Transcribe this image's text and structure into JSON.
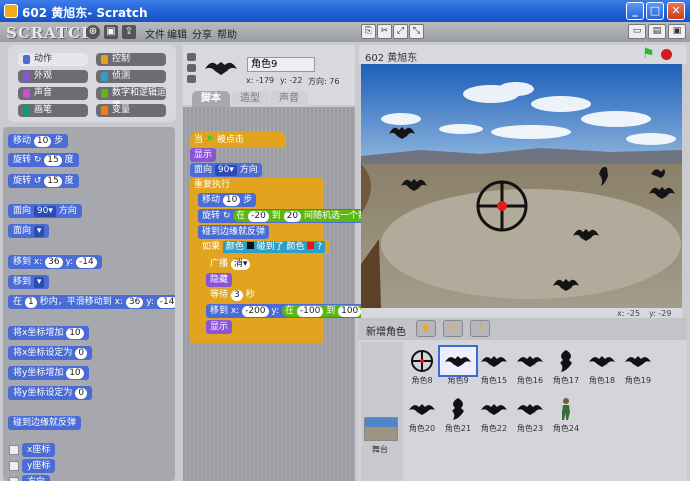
{
  "window": {
    "title": "602 黄旭东- Scratch"
  },
  "menu": {
    "logo": "SCRATCH",
    "items": [
      "文件",
      "编辑",
      "分享",
      "帮助"
    ]
  },
  "categories": [
    {
      "label": "动作",
      "color": "#4a6cd4",
      "selected": true
    },
    {
      "label": "控制",
      "color": "#e2a41f"
    },
    {
      "label": "外观",
      "color": "#8a55d7"
    },
    {
      "label": "侦测",
      "color": "#2f9fc9"
    },
    {
      "label": "声音",
      "color": "#cf4ad9"
    },
    {
      "label": "数字和逻辑运算",
      "color": "#5cb712"
    },
    {
      "label": "画笔",
      "color": "#0e9a6c"
    },
    {
      "label": "变量",
      "color": "#ee7d16"
    }
  ],
  "palette": {
    "move": {
      "a": "移动",
      "n": "10",
      "b": "步"
    },
    "turn_cw": {
      "a": "旋转",
      "n": "15",
      "b": "度"
    },
    "turn_ccw": {
      "a": "旋转",
      "n": "15",
      "b": "度"
    },
    "point_dir": {
      "a": "面向",
      "n": "90▾",
      "b": "方向"
    },
    "point_towards": {
      "a": "面向"
    },
    "goto_xy": {
      "a": "移到 x:",
      "x": "36",
      "b": "y:",
      "y": "-14"
    },
    "goto": {
      "a": "移到"
    },
    "glide": {
      "a": "在",
      "n": "1",
      "b": "秒内，平滑移动到 x:",
      "x": "36",
      "c": "y:",
      "y": "-14"
    },
    "change_x": {
      "a": "将x坐标增加",
      "n": "10"
    },
    "set_x": {
      "a": "将x坐标设定为",
      "n": "0"
    },
    "change_y": {
      "a": "将y坐标增加",
      "n": "10"
    },
    "set_y": {
      "a": "将y坐标设定为",
      "n": "0"
    },
    "bounce": "碰到边缘就反弹",
    "xpos": "x座标",
    "ypos": "y座标",
    "dir": "方向"
  },
  "sprite": {
    "name": "角色9",
    "x": "x: -179",
    "y": "y: -22",
    "dir": "方向: 76"
  },
  "tabs": [
    "脚本",
    "造型",
    "声音"
  ],
  "script": {
    "hat": "当",
    "hat2": "被点击",
    "show": "显示",
    "face": "面向",
    "face_n": "90▾",
    "face_b": "方向",
    "forever": "重复执行",
    "move": "移动",
    "move_n": "10",
    "move_b": "步",
    "turn": "旋转",
    "turn_a": "在",
    "turn_lo": "-20",
    "turn_to": "到",
    "turn_hi": "20",
    "turn_c": "间随机选一个数",
    "bounce": "碰到边缘就反弹",
    "if": "如果",
    "if_cond": "颜色",
    "if_mid": "碰到了 颜色",
    "if_q": "?",
    "broadcast": "广播",
    "broadcast_v": "消▾",
    "hide": "隐藏",
    "wait": "等待",
    "wait_n": "3",
    "wait_b": "秒",
    "goto": "移到 x:",
    "goto_x": "-200",
    "goto_y": "y:",
    "goto_a": "在",
    "goto_lo": "-100",
    "goto_to": "到",
    "goto_hi": "100",
    "goto_c": "间随",
    "show2": "显示"
  },
  "stage": {
    "title": "602 黄旭东",
    "mouse_x": "x: -25",
    "mouse_y": "y: -29"
  },
  "library": {
    "new_sprite": "新增角色",
    "stage_label": "舞台",
    "sprites": [
      "角色8",
      "角色9",
      "角色15",
      "角色16",
      "角色17",
      "角色18",
      "角色19",
      "角色20",
      "角色21",
      "角色22",
      "角色23",
      "角色24"
    ]
  }
}
